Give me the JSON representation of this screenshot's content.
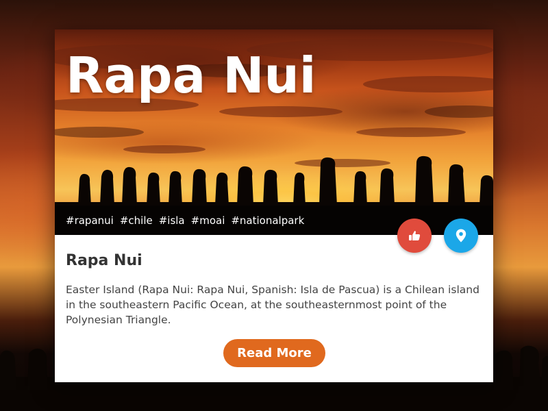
{
  "card": {
    "hero_title": "Rapa Nui",
    "tags": [
      "#rapanui",
      "#chile",
      "#isla",
      "#moai",
      "#nationalpark"
    ],
    "title": "Rapa Nui",
    "description": "Easter Island (Rapa Nui: Rapa Nui, Spanish: Isla de Pascua) is a Chilean island in the southeastern Pacific Ocean, at the southeasternmost point of the Polynesian Triangle.",
    "read_more_label": "Read More",
    "like_icon": "thumbs-up-icon",
    "location_icon": "map-pin-icon"
  },
  "colors": {
    "like_button": "#e04b3c",
    "location_button": "#1ba7e8",
    "read_more_button": "#e0691e",
    "tag_bar": "#050302"
  }
}
